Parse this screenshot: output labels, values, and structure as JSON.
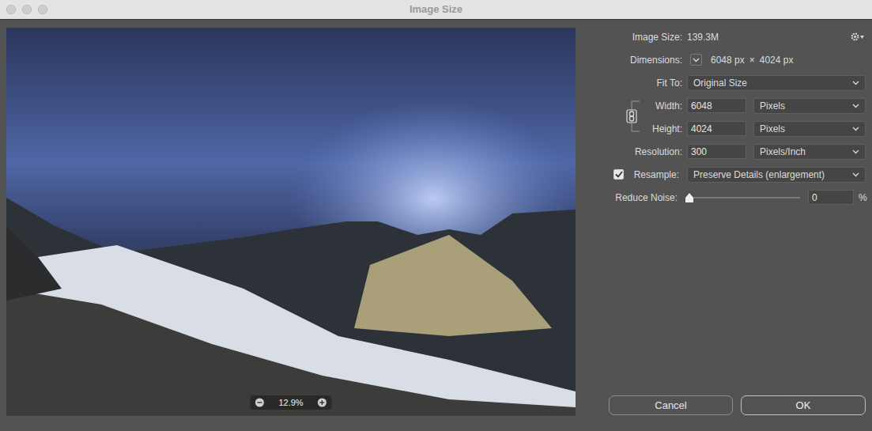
{
  "window": {
    "title": "Image Size"
  },
  "preview": {
    "zoom": "12.9%"
  },
  "info": {
    "image_size_label": "Image Size:",
    "image_size": "139.3M",
    "dimensions_label": "Dimensions:",
    "width": "6048 px",
    "times": "×",
    "height": "4024 px"
  },
  "fit_to": {
    "label": "Fit To:",
    "value": "Original Size"
  },
  "constrain": {
    "linked": true
  },
  "width": {
    "label": "Width:",
    "value": "6048",
    "unit": "Pixels"
  },
  "height": {
    "label": "Height:",
    "value": "4024",
    "unit": "Pixels"
  },
  "resolution": {
    "label": "Resolution:",
    "value": "300",
    "unit": "Pixels/Inch"
  },
  "resample": {
    "label": "Resample:",
    "checked": true,
    "value": "Preserve Details (enlargement)"
  },
  "reduce_noise": {
    "label": "Reduce Noise:",
    "level": 0,
    "value": "0",
    "unit": "%"
  },
  "buttons": [
    {
      "label": "Cancel",
      "default": false
    },
    {
      "label": "OK",
      "default": true
    }
  ]
}
